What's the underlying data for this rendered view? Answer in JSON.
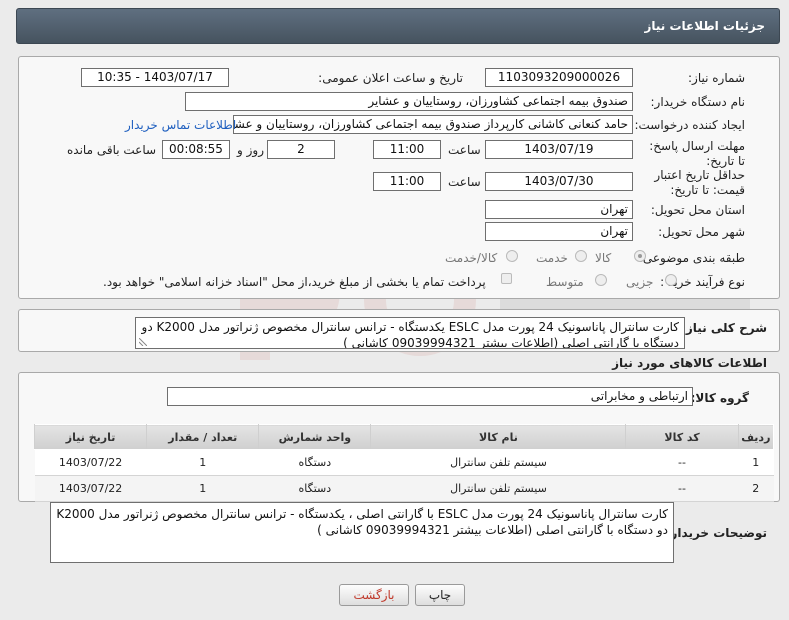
{
  "page": {
    "title": "جزئیات اطلاعات نیاز"
  },
  "form": {
    "need_number_label": "شماره نیاز:",
    "need_number": "1103093209000026",
    "announce_label": "تاریخ و ساعت اعلان عمومی:",
    "announce_value": "1403/07/17 - 10:35",
    "buyer_org_label": "نام دستگاه خریدار:",
    "buyer_org": "صندوق بیمه اجتماعی کشاورزان، روستاییان و عشایر",
    "requester_label": "ایجاد کننده درخواست:",
    "requester": "حامد کنعانی کاشانی کارپرداز صندوق بیمه اجتماعی کشاورزان، روستاییان و عشایر",
    "contact_link": "اطلاعات تماس خریدار",
    "reply_deadline_label": "مهلت ارسال پاسخ: تا تاریخ:",
    "reply_date": "1403/07/19",
    "time_label": "ساعت",
    "reply_time": "11:00",
    "days_value": "2",
    "days_label": "روز و",
    "remaining_time": "00:08:55",
    "remaining_label": "ساعت باقی مانده",
    "validity_label": "حداقل تاریخ اعتبار قیمت: تا تاریخ:",
    "validity_date": "1403/07/30",
    "validity_time": "11:00",
    "province_label": "استان محل تحویل:",
    "province": "تهران",
    "city_label": "شهر محل تحویل:",
    "city": "تهران",
    "category_label": "طبقه بندی موضوعی:",
    "category_options": [
      "کالا",
      "خدمت",
      "کالا/خدمت"
    ],
    "category_selected": "کالا",
    "process_label": "نوع فرآیند خرید :",
    "process_options": [
      "جزیی",
      "متوسط"
    ],
    "payment_note": "پرداخت تمام یا بخشی از مبلغ خرید،از محل \"اسناد خزانه اسلامی\" خواهد بود."
  },
  "description": {
    "label": "شرح کلی نیاز:",
    "text": "کارت سانترال پاناسونیک 24 پورت مدل ESLC یکدستگاه - ترانس سانترال مخصوص ژنراتور مدل K2000 دو دستگاه با گارانتی اصلی (اطلاعات بیشتر 09039994321 کاشانی )"
  },
  "goods": {
    "section_title": "اطلاعات کالاهای مورد نیاز",
    "group_label": "گروه کالا:",
    "group_value": "ارتباطی و مخابراتی",
    "columns": [
      "ردیف",
      "کد کالا",
      "نام کالا",
      "واحد شمارش",
      "تعداد / مقدار",
      "تاریخ نیاز"
    ],
    "rows": [
      [
        "1",
        "--",
        "سیستم تلفن سانترال",
        "دستگاه",
        "1",
        "1403/07/22"
      ],
      [
        "2",
        "--",
        "سیستم تلفن سانترال",
        "دستگاه",
        "1",
        "1403/07/22"
      ]
    ]
  },
  "buyer_notes": {
    "label": "توضیحات خریدار:",
    "text": "کارت سانترال پاناسونیک 24 پورت مدل ESLC با گارانتی اصلی ، یکدستگاه - ترانس سانترال مخصوص ژنراتور مدل K2000 دو دستگاه با گارانتی اصلی (اطلاعات بیشتر 09039994321 کاشانی )"
  },
  "buttons": {
    "print": "چاپ",
    "back": "بازگشت"
  },
  "colors": {
    "header": "#5f6f80",
    "link": "#1f5fbf",
    "back_button_text": "#c0392b"
  }
}
